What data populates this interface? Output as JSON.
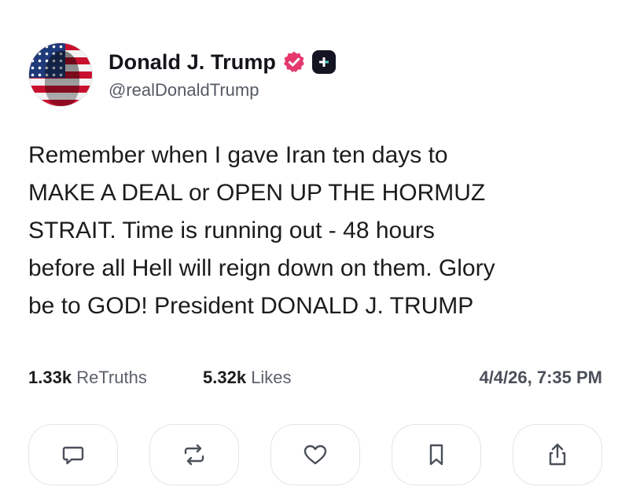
{
  "post": {
    "author": {
      "display_name": "Donald J. Trump",
      "handle": "@realDonaldTrump",
      "verified_icon": "verified-badge-icon",
      "platform_icon": "truth-social-icon"
    },
    "text": "Remember when I gave Iran ten days to\nMAKE A DEAL or OPEN UP THE HORMUZ\nSTRAIT. Time is running out - 48 hours\nbefore all Hell will reign down on them. Glory\nbe to GOD! President DONALD J. TRUMP",
    "stats": {
      "retruths_count": "1.33k",
      "retruths_label": "ReTruths",
      "likes_count": "5.32k",
      "likes_label": "Likes",
      "timestamp": "4/4/26, 7:35 PM"
    },
    "actions": [
      {
        "icon": "reply-icon"
      },
      {
        "icon": "retruth-icon"
      },
      {
        "icon": "like-icon"
      },
      {
        "icon": "bookmark-icon"
      },
      {
        "icon": "share-icon"
      }
    ]
  },
  "colors": {
    "verified": "#e5386d",
    "text": "#1c1c1e",
    "muted": "#5b606b",
    "border": "#e4e4ea"
  }
}
